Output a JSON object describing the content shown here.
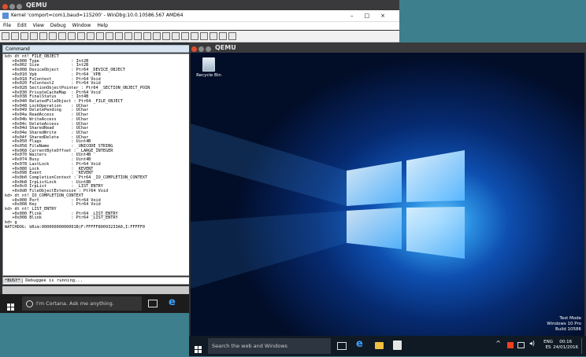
{
  "qemu_left": {
    "app_title": "QEMU",
    "window_title": "Kernel 'comport=com1,baud=115200' - WinDbg:10.0.10586.567 AMD64",
    "menu": [
      "File",
      "Edit",
      "View",
      "Debug",
      "Window",
      "Help"
    ],
    "command_pane_title": "Command",
    "console_lines": [
      "kd> dt nt!_FILE_OBJECT",
      "   +0x000 Type             : Int2B",
      "   +0x002 Size             : Int2B",
      "   +0x008 DeviceObject     : Ptr64 _DEVICE_OBJECT",
      "   +0x010 Vpb              : Ptr64 _VPB",
      "   +0x018 FsContext        : Ptr64 Void",
      "   +0x020 FsContext2       : Ptr64 Void",
      "   +0x028 SectionObjectPointer : Ptr64 _SECTION_OBJECT_POIN",
      "   +0x030 PrivateCacheMap  : Ptr64 Void",
      "   +0x038 FinalStatus      : Int4B",
      "   +0x040 RelatedFileObject : Ptr64 _FILE_OBJECT",
      "   +0x048 LockOperation    : UChar",
      "   +0x049 DeletePending    : UChar",
      "   +0x04a ReadAccess       : UChar",
      "   +0x04b WriteAccess      : UChar",
      "   +0x04c DeleteAccess     : UChar",
      "   +0x04d SharedRead       : UChar",
      "   +0x04e SharedWrite      : UChar",
      "   +0x04f SharedDelete     : UChar",
      "   +0x050 Flags            : Uint4B",
      "   +0x058 FileName         : _UNICODE_STRING",
      "   +0x068 CurrentByteOffset : _LARGE_INTEGER",
      "   +0x070 Waiters          : Uint4B",
      "   +0x074 Busy             : Uint4B",
      "   +0x078 LastLock         : Ptr64 Void",
      "   +0x080 Lock             : _KEVENT",
      "   +0x098 Event            : _KEVENT",
      "   +0x0b0 CompletionContext : Ptr64 _IO_COMPLETION_CONTEXT",
      "   +0x0b8 IrpListLock      : Uint8B",
      "   +0x0c0 IrpList          : _LIST_ENTRY",
      "   +0x0d0 FileObjectExtension : Ptr64 Void",
      "kd> dt nt!_IO_COMPLETION_CONTEXT",
      "   +0x000 Port             : Ptr64 Void",
      "   +0x008 Key              : Ptr64 Void",
      "kd> dt nt!_LIST_ENTRY",
      "   +0x000 Flink            : Ptr64 _LIST_ENTRY",
      "   +0x008 Blink            : Ptr64 _LIST_ENTRY",
      "kd> g",
      "WATCHDOG: bRim:00000000000001B(F:FFFFF80093233A0,I:FFFFF0"
    ],
    "busy_label": "*BUSY*",
    "status_text": "Debuggee is running...",
    "taskbar_search": "I'm Cortana. Ask me anything."
  },
  "qemu_right": {
    "app_title": "QEMU",
    "recycle_bin_label": "Recycle Bin",
    "watermark": [
      "Test Mode",
      "Windows 10 Pro",
      "Build 10586"
    ],
    "taskbar_search": "Search the web and Windows",
    "tray_lang": [
      "ENG",
      "ES"
    ],
    "tray_time": "00:16",
    "tray_date": "24/01/2016"
  },
  "colors": {
    "desktop_bg": "#3d7f8c",
    "ubuntu_titlebar": "#3a3a3c",
    "close_button": "#e04e2c"
  }
}
